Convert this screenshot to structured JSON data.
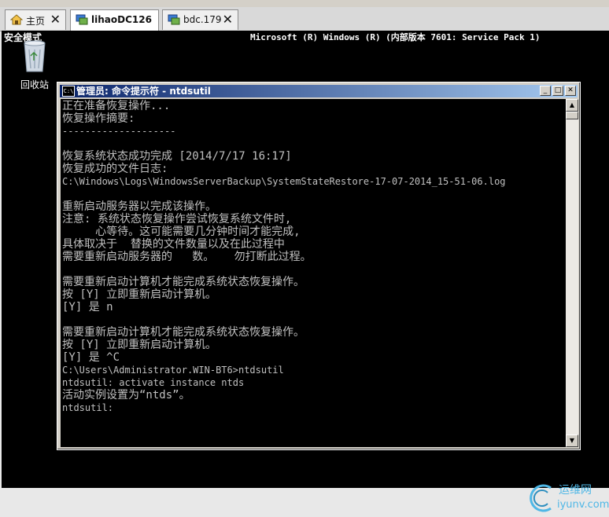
{
  "browser_tabs": [
    {
      "label": "主页",
      "icon": "home-icon",
      "active": false
    },
    {
      "label": "lihaoDC126",
      "icon": "remote-desktop-icon",
      "active": true
    },
    {
      "label": "bdc.179",
      "icon": "remote-desktop-icon",
      "active": false
    }
  ],
  "desktop": {
    "safe_mode": "安全模式",
    "system_line": "Microsoft (R) Windows (R) (内部版本 7601: Service Pack 1)",
    "recycle_bin": "回收站"
  },
  "window": {
    "icon_text": "C:\\",
    "title": "管理员: 命令提示符 - ntdsutil"
  },
  "console_lines": [
    "正在准备恢复操作...",
    "恢复操作摘要:",
    "--------------------",
    "",
    "恢复系统状态成功完成 [2014/7/17 16:17]",
    "恢复成功的文件日志:",
    "C:\\Windows\\Logs\\WindowsServerBackup\\SystemStateRestore-17-07-2014_15-51-06.log",
    "",
    "重新启动服务器以完成该操作。",
    "注意: 系统状态恢复操作尝试恢复系统文件时,",
    "     心等待。这可能需要几分钟时间才能完成,",
    "具体取决于  替换的文件数量以及在此过程中",
    "需要重新启动服务器的   数。   勿打断此过程。",
    "",
    "需要重新启动计算机才能完成系统状态恢复操作。",
    "按 [Y] 立即重新启动计算机。",
    "[Y] 是 n",
    "",
    "需要重新启动计算机才能完成系统状态恢复操作。",
    "按 [Y] 立即重新启动计算机。",
    "[Y] 是 ^C",
    "C:\\Users\\Administrator.WIN-BT6>ntdsutil",
    "ntdsutil: activate instance ntds",
    "活动实例设置为“ntds”。",
    "ntdsutil:"
  ],
  "watermark": {
    "line1": "运维网",
    "line2": "iyunv.com"
  },
  "colors": {
    "title_bar": "#0a246a",
    "console_bg": "#000000",
    "console_text": "#c0c0c0",
    "watermark": "#4fb7e6"
  }
}
